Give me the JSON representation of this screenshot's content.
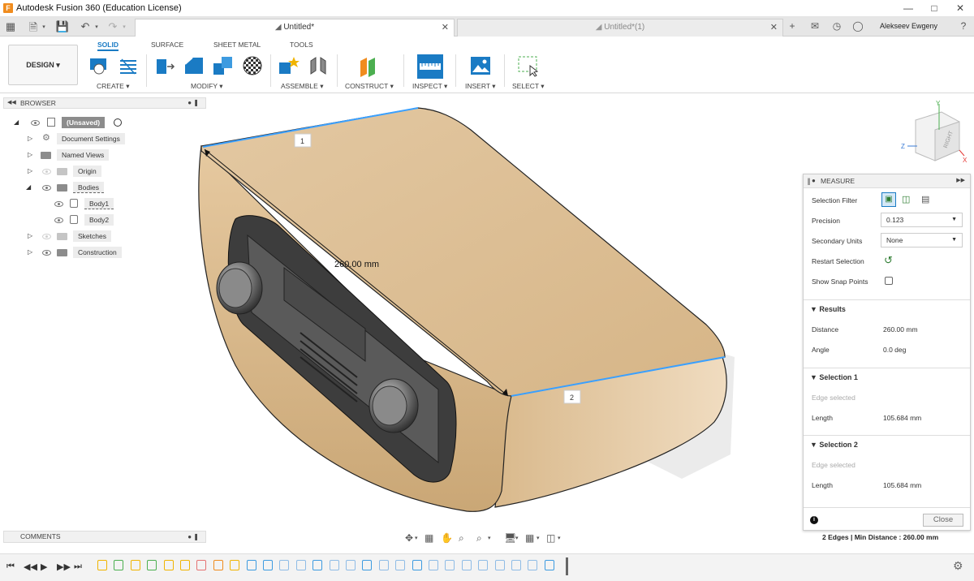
{
  "titlebar": {
    "app_title": "Autodesk Fusion 360 (Education License)",
    "logo_letter": "F"
  },
  "tabs": [
    {
      "label": "Untitled*"
    },
    {
      "label": "Untitled*(1)"
    }
  ],
  "user": {
    "name": "Alekseev Ewgeny"
  },
  "ribbon": {
    "design_label": "DESIGN",
    "tabs": [
      "SOLID",
      "SURFACE",
      "SHEET METAL",
      "TOOLS"
    ],
    "groups": [
      "CREATE",
      "MODIFY",
      "ASSEMBLE",
      "CONSTRUCT",
      "INSPECT",
      "INSERT",
      "SELECT"
    ]
  },
  "browser": {
    "title": "BROWSER",
    "items": [
      {
        "label": "(Unsaved)"
      },
      {
        "label": "Document Settings"
      },
      {
        "label": "Named Views"
      },
      {
        "label": "Origin"
      },
      {
        "label": "Bodies"
      },
      {
        "label": "Body1"
      },
      {
        "label": "Body2"
      },
      {
        "label": "Sketches"
      },
      {
        "label": "Construction"
      }
    ]
  },
  "comments": {
    "title": "COMMENTS"
  },
  "viewport": {
    "dimension_label": "260.00 mm",
    "point1_label": "1",
    "point2_label": "2",
    "viewcube_face": "RIGHT",
    "axes": {
      "y": "Y",
      "z": "Z",
      "x": "X"
    }
  },
  "measure": {
    "title": "MEASURE",
    "selection_filter_label": "Selection Filter",
    "precision_label": "Precision",
    "precision_value": "0.123",
    "secondary_units_label": "Secondary Units",
    "secondary_units_value": "None",
    "restart_selection_label": "Restart Selection",
    "show_snap_points_label": "Show Snap Points",
    "results_title": "Results",
    "distance_label": "Distance",
    "distance_value": "260.00 mm",
    "angle_label": "Angle",
    "angle_value": "0.0 deg",
    "selection1_title": "Selection 1",
    "selection1_status": "Edge selected",
    "selection1_length_label": "Length",
    "selection1_length_value": "105.684 mm",
    "selection2_title": "Selection 2",
    "selection2_status": "Edge selected",
    "selection2_length_label": "Length",
    "selection2_length_value": "105.684 mm",
    "close_label": "Close",
    "status_text": "2 Edges | Min Distance : 260.00 mm"
  },
  "colors": {
    "accent": "#1a7bc4",
    "body": "#e2c49b",
    "panel": "#3c3c3c"
  },
  "icons": [
    "grid-icon",
    "file-icon",
    "save-icon",
    "undo-icon",
    "redo-icon",
    "extrude-icon",
    "fillet-icon",
    "measure-icon",
    "settings-icon",
    "info-icon"
  ]
}
